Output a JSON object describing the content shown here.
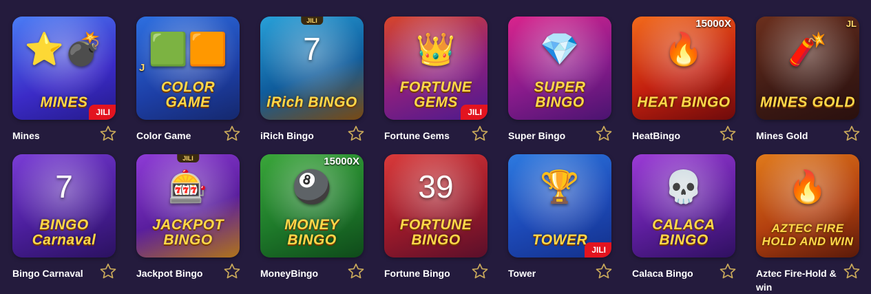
{
  "colors": {
    "background": "#241b3d",
    "star_outline": "#c8a85a",
    "jili_badge": "#e3141f"
  },
  "games": [
    {
      "name": "Mines",
      "logo": "MINES",
      "art": "⭐💣",
      "badge_corner": "JILI",
      "bg": "linear-gradient(160deg,#4a7cf5,#3b2bc7 60%,#241a8a)"
    },
    {
      "name": "Color Game",
      "logo": "COLOR GAME",
      "art": "🟩🟧",
      "badge_left": "J",
      "bg": "linear-gradient(160deg,#2d6fe0,#1d3fa6 60%,#15286d)"
    },
    {
      "name": "iRich Bingo",
      "logo": "iRich BINGO",
      "art": "7",
      "badge_top": "JILI",
      "bg": "linear-gradient(160deg,#28a0d8,#0f5c9c 55%,#7a4a12)"
    },
    {
      "name": "Fortune Gems",
      "logo": "FORTUNE GEMS",
      "art": "👑",
      "badge_corner": "JILI",
      "bg": "linear-gradient(160deg,#d7452a,#8b1f7f 55%,#4c1a8c)"
    },
    {
      "name": "Super Bingo",
      "logo": "SUPER BINGO",
      "art": "💎",
      "bg": "linear-gradient(160deg,#d9248c,#8a1b8c 55%,#4a1470)"
    },
    {
      "name": "HeatBingo",
      "logo": "HEAT BINGO",
      "art": "🔥",
      "multiplier": "15000X",
      "bg": "linear-gradient(160deg,#f26a1b,#c3200f 55%,#6e0b0b)"
    },
    {
      "name": "Mines Gold",
      "logo": "MINES GOLD",
      "art": "🧨",
      "badge_tr": "JL",
      "bg": "linear-gradient(160deg,#6b2f1d,#3d1a14 60%,#2a100e)"
    },
    {
      "name": "Bingo Carnaval",
      "logo": "BINGO Carnaval",
      "art": "7",
      "bg": "linear-gradient(160deg,#7a3dd6,#4b1e9c 55%,#2b1260)"
    },
    {
      "name": "Jackpot Bingo",
      "logo": "JACKPOT BINGO",
      "art": "🎰",
      "badge_top": "JILI",
      "bg": "linear-gradient(160deg,#8e3bd6,#5a1e9e 55%,#b0741a)"
    },
    {
      "name": "MoneyBingo",
      "logo": "MONEY BINGO",
      "art": "🎱",
      "multiplier": "15000X",
      "bg": "linear-gradient(160deg,#3aa63a,#1e7a2a 55%,#0f4a1a)"
    },
    {
      "name": "Fortune Bingo",
      "logo": "FORTUNE BINGO",
      "art": "39",
      "bg": "linear-gradient(160deg,#d93a3a,#9c1a2a 55%,#5a0f2a)"
    },
    {
      "name": "Tower",
      "logo": "TOWER",
      "art": "🏆",
      "badge_corner": "JILI",
      "bg": "linear-gradient(160deg,#2d7ae0,#1d4ab8 55%,#13308a)"
    },
    {
      "name": "Calaca Bingo",
      "logo": "CALACA BINGO",
      "art": "💀",
      "bg": "linear-gradient(160deg,#9b3bd6,#5e1e9e 55%,#2f1060)"
    },
    {
      "name": "Aztec Fire-Hold & win",
      "logo": "AZTEC FIRE HOLD AND WIN",
      "art": "🔥",
      "bg": "linear-gradient(160deg,#e07a1b,#b3400f 55%,#5a1a0a)"
    }
  ]
}
